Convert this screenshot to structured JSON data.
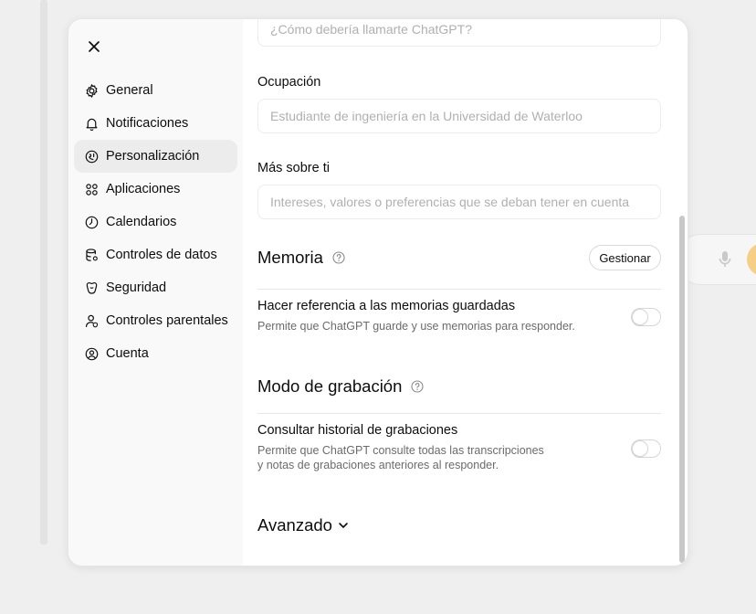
{
  "sidebar": {
    "items": [
      {
        "label": "General",
        "icon": "gear-icon"
      },
      {
        "label": "Notificaciones",
        "icon": "bell-icon"
      },
      {
        "label": "Personalización",
        "icon": "personalization-icon",
        "active": true
      },
      {
        "label": "Aplicaciones",
        "icon": "apps-grid-icon"
      },
      {
        "label": "Calendarios",
        "icon": "clock-icon"
      },
      {
        "label": "Controles de datos",
        "icon": "database-icon"
      },
      {
        "label": "Seguridad",
        "icon": "shield-icon"
      },
      {
        "label": "Controles parentales",
        "icon": "parent-user-icon"
      },
      {
        "label": "Cuenta",
        "icon": "user-circle-icon"
      }
    ]
  },
  "personalization": {
    "nickname_placeholder": "¿Cómo debería llamarte ChatGPT?",
    "occupation_label": "Ocupación",
    "occupation_placeholder": "Estudiante de ingeniería en la Universidad de Waterloo",
    "more_label": "Más sobre ti",
    "more_placeholder": "Intereses, valores o preferencias que se deban tener en cuenta"
  },
  "memory": {
    "title": "Memoria",
    "manage_label": "Gestionar",
    "saved_title": "Hacer referencia a las memorias guardadas",
    "saved_desc": "Permite que ChatGPT guarde y use memorias para responder.",
    "saved_enabled": false
  },
  "recording": {
    "title": "Modo de grabación",
    "history_title": "Consultar historial de grabaciones",
    "history_desc_1": "Permite que ChatGPT consulte todas las transcripciones",
    "history_desc_2": "y notas de grabaciones anteriores al responder.",
    "history_enabled": false
  },
  "advanced_label": "Avanzado",
  "colors": {
    "sidebar_bg": "#f9f9f9",
    "active_item_bg": "#ececec",
    "backdrop": "#efefef"
  }
}
